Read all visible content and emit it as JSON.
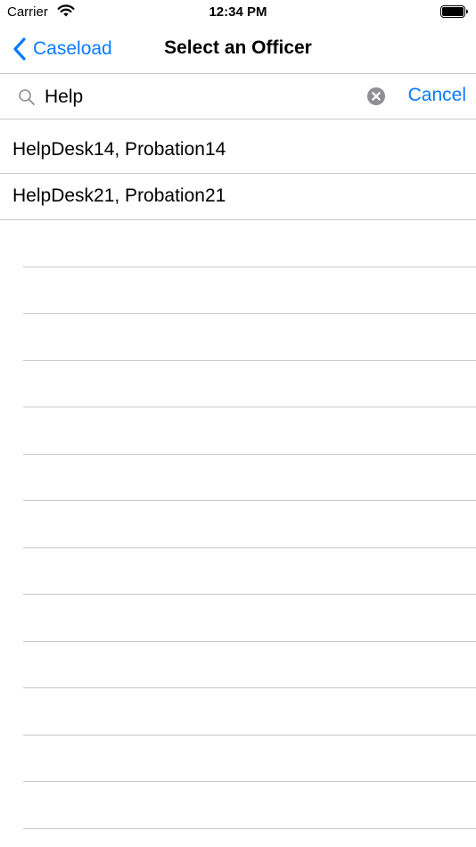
{
  "status_bar": {
    "carrier": "Carrier",
    "time": "12:34 PM",
    "icons": [
      "wifi-icon",
      "battery-icon"
    ]
  },
  "nav": {
    "back_label": "Caseload",
    "title": "Select an Officer",
    "back_icon": "chevron-left-icon"
  },
  "search": {
    "value": "Help",
    "cancel_label": "Cancel",
    "icons": [
      "search-icon",
      "clear-icon"
    ]
  },
  "results": [
    {
      "label": "HelpDesk14, Probation14"
    },
    {
      "label": "HelpDesk21, Probation21"
    }
  ],
  "colors": {
    "accent": "#0a7aff",
    "separator": "#c8c7cc",
    "clear_icon": "#8e8e93"
  }
}
